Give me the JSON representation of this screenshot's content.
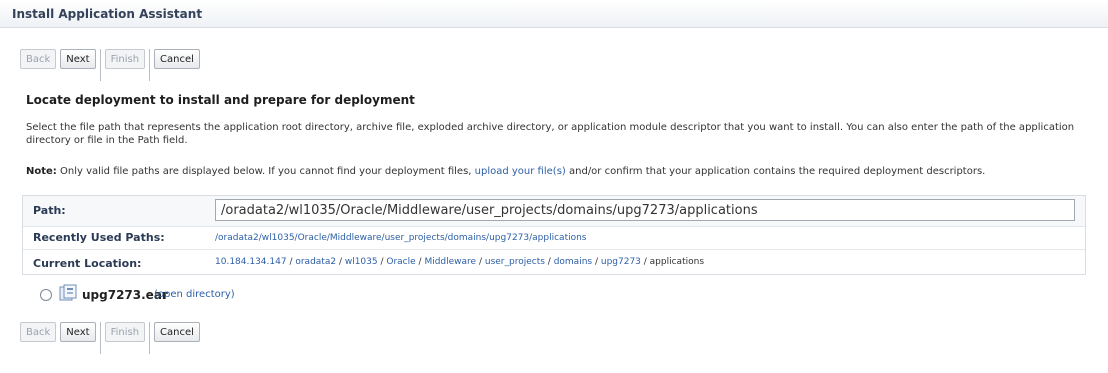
{
  "window": {
    "title": "Install Application Assistant"
  },
  "toolbar": {
    "back": "Back",
    "next": "Next",
    "finish": "Finish",
    "cancel": "Cancel"
  },
  "section": {
    "heading": "Locate deployment to install and prepare for deployment",
    "description": "Select the file path that represents the application root directory, archive file, exploded archive directory, or application module descriptor that you want to install. You can also enter the path of the application directory or file in the Path field.",
    "note_label": "Note:",
    "note_text_1": "Only valid file paths are displayed below. If you cannot find your deployment files,",
    "note_link": "upload your file(s)",
    "note_text_2": "and/or confirm that your application contains the required deployment descriptors."
  },
  "form": {
    "path_label": "Path:",
    "path_value": "/oradata2/wl1035/Oracle/Middleware/user_projects/domains/upg7273/applications",
    "recent_label": "Recently Used Paths:",
    "recent_path": "/oradata2/wl1035/Oracle/Middleware/user_projects/domains/upg7273/applications",
    "current_label": "Current Location:",
    "current_location": [
      {
        "text": "10.184.134.147",
        "link": true
      },
      {
        "text": "oradata2",
        "link": true
      },
      {
        "text": "wl1035",
        "link": true
      },
      {
        "text": "Oracle",
        "link": true
      },
      {
        "text": "Middleware",
        "link": true
      },
      {
        "text": "user_projects",
        "link": true
      },
      {
        "text": "domains",
        "link": true
      },
      {
        "text": "upg7273",
        "link": true
      },
      {
        "text": "applications",
        "link": false
      }
    ]
  },
  "files": [
    {
      "name": "upg7273.ear",
      "action": "(open directory)",
      "icon": "archive-file-icon"
    }
  ]
}
